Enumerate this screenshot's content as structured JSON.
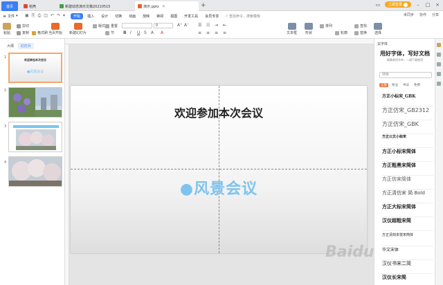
{
  "titlebar": {
    "home": "首页",
    "tabs": [
      {
        "label": "稻壳",
        "icon_color": "#e0463f"
      },
      {
        "label": "新建动态演示文稿20210515",
        "icon_color": "#43a047"
      },
      {
        "label": "演示.pptx",
        "icon_color": "#e8612c"
      }
    ],
    "login": "立即登录"
  },
  "menubar": {
    "file": "文件",
    "items": [
      "开始",
      "插入",
      "设计",
      "切换",
      "动画",
      "放映",
      "审阅",
      "视图",
      "开发工具",
      "会员专享"
    ],
    "search": "查找命令、搜索模板",
    "right": [
      "未同步",
      "协作",
      "分享"
    ]
  },
  "ribbon": {
    "paste": "粘贴",
    "cut": "剪切",
    "copy": "复制",
    "format_painter": "格式刷",
    "play": "当页开始",
    "new_slide": "新建幻灯片",
    "layout": "版式",
    "section": "节",
    "reset": "重置",
    "font_size": "0",
    "textbox": "文本框",
    "shape": "形状",
    "arrange": "排列",
    "outline": "轮廓",
    "find": "查找",
    "replace": "替换",
    "select": "选择"
  },
  "left_panel": {
    "tabs": [
      "大纲",
      "幻灯片"
    ],
    "thumbs": [
      {
        "num": "1",
        "title": "欢迎参加本次会议",
        "sub": "●风景会议"
      },
      {
        "num": "2"
      },
      {
        "num": "3"
      },
      {
        "num": "4"
      }
    ]
  },
  "slide": {
    "title": "欢迎参加本次会议",
    "subtitle": "●风景会议"
  },
  "right_panel": {
    "header": "云字体",
    "promo": "用好字体，写好文档",
    "promo_sub": "精美商用字库，一键下载使用",
    "search": "搜索",
    "filters": [
      "全部",
      "商业",
      "书法",
      "免费"
    ],
    "fonts": [
      "方正小标宋_GBK",
      "方正仿宋_GB2312",
      "方正仿宋_GBK",
      "方正公文小标宋",
      "方正小标宋简体",
      "方正粗黑宋简体",
      "方正仿宋简体",
      "方正清仿宋 简 Bold",
      "方正大标宋简体",
      "汉仪超粗宋简",
      "方正清刻本悦宋简体",
      "华文宋体",
      "汉仪书宋二简",
      "汉仪长宋简"
    ]
  },
  "watermark": "Baidu"
}
